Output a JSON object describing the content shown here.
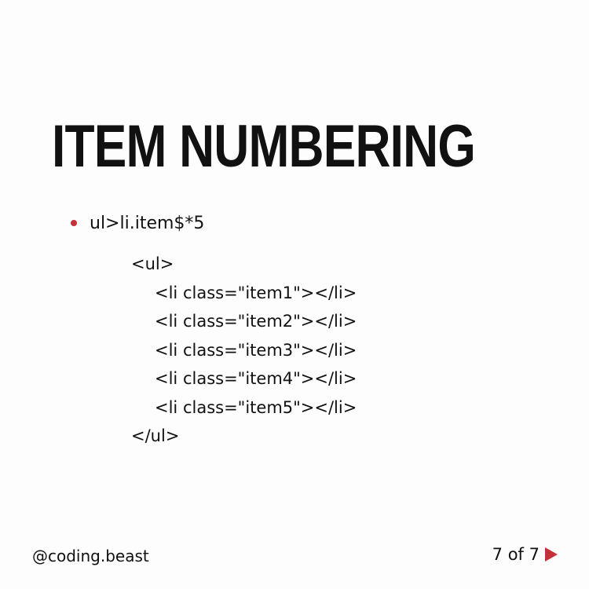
{
  "slide": {
    "title": "ITEM NUMBERING",
    "bullet": "ul>li.item$*5",
    "code_lines": [
      "<ul>",
      "<li class=\"item1\"></li>",
      "<li class=\"item2\"></li>",
      "<li class=\"item3\"></li>",
      "<li class=\"item4\"></li>",
      "<li class=\"item5\"></li>",
      "</ul>"
    ]
  },
  "footer": {
    "handle": "@coding.beast",
    "page_indicator": "7 of 7",
    "next_icon": "play-triangle-icon"
  },
  "colors": {
    "accent": "#c4303a",
    "text": "#111111",
    "background": "#fdfdfd"
  }
}
